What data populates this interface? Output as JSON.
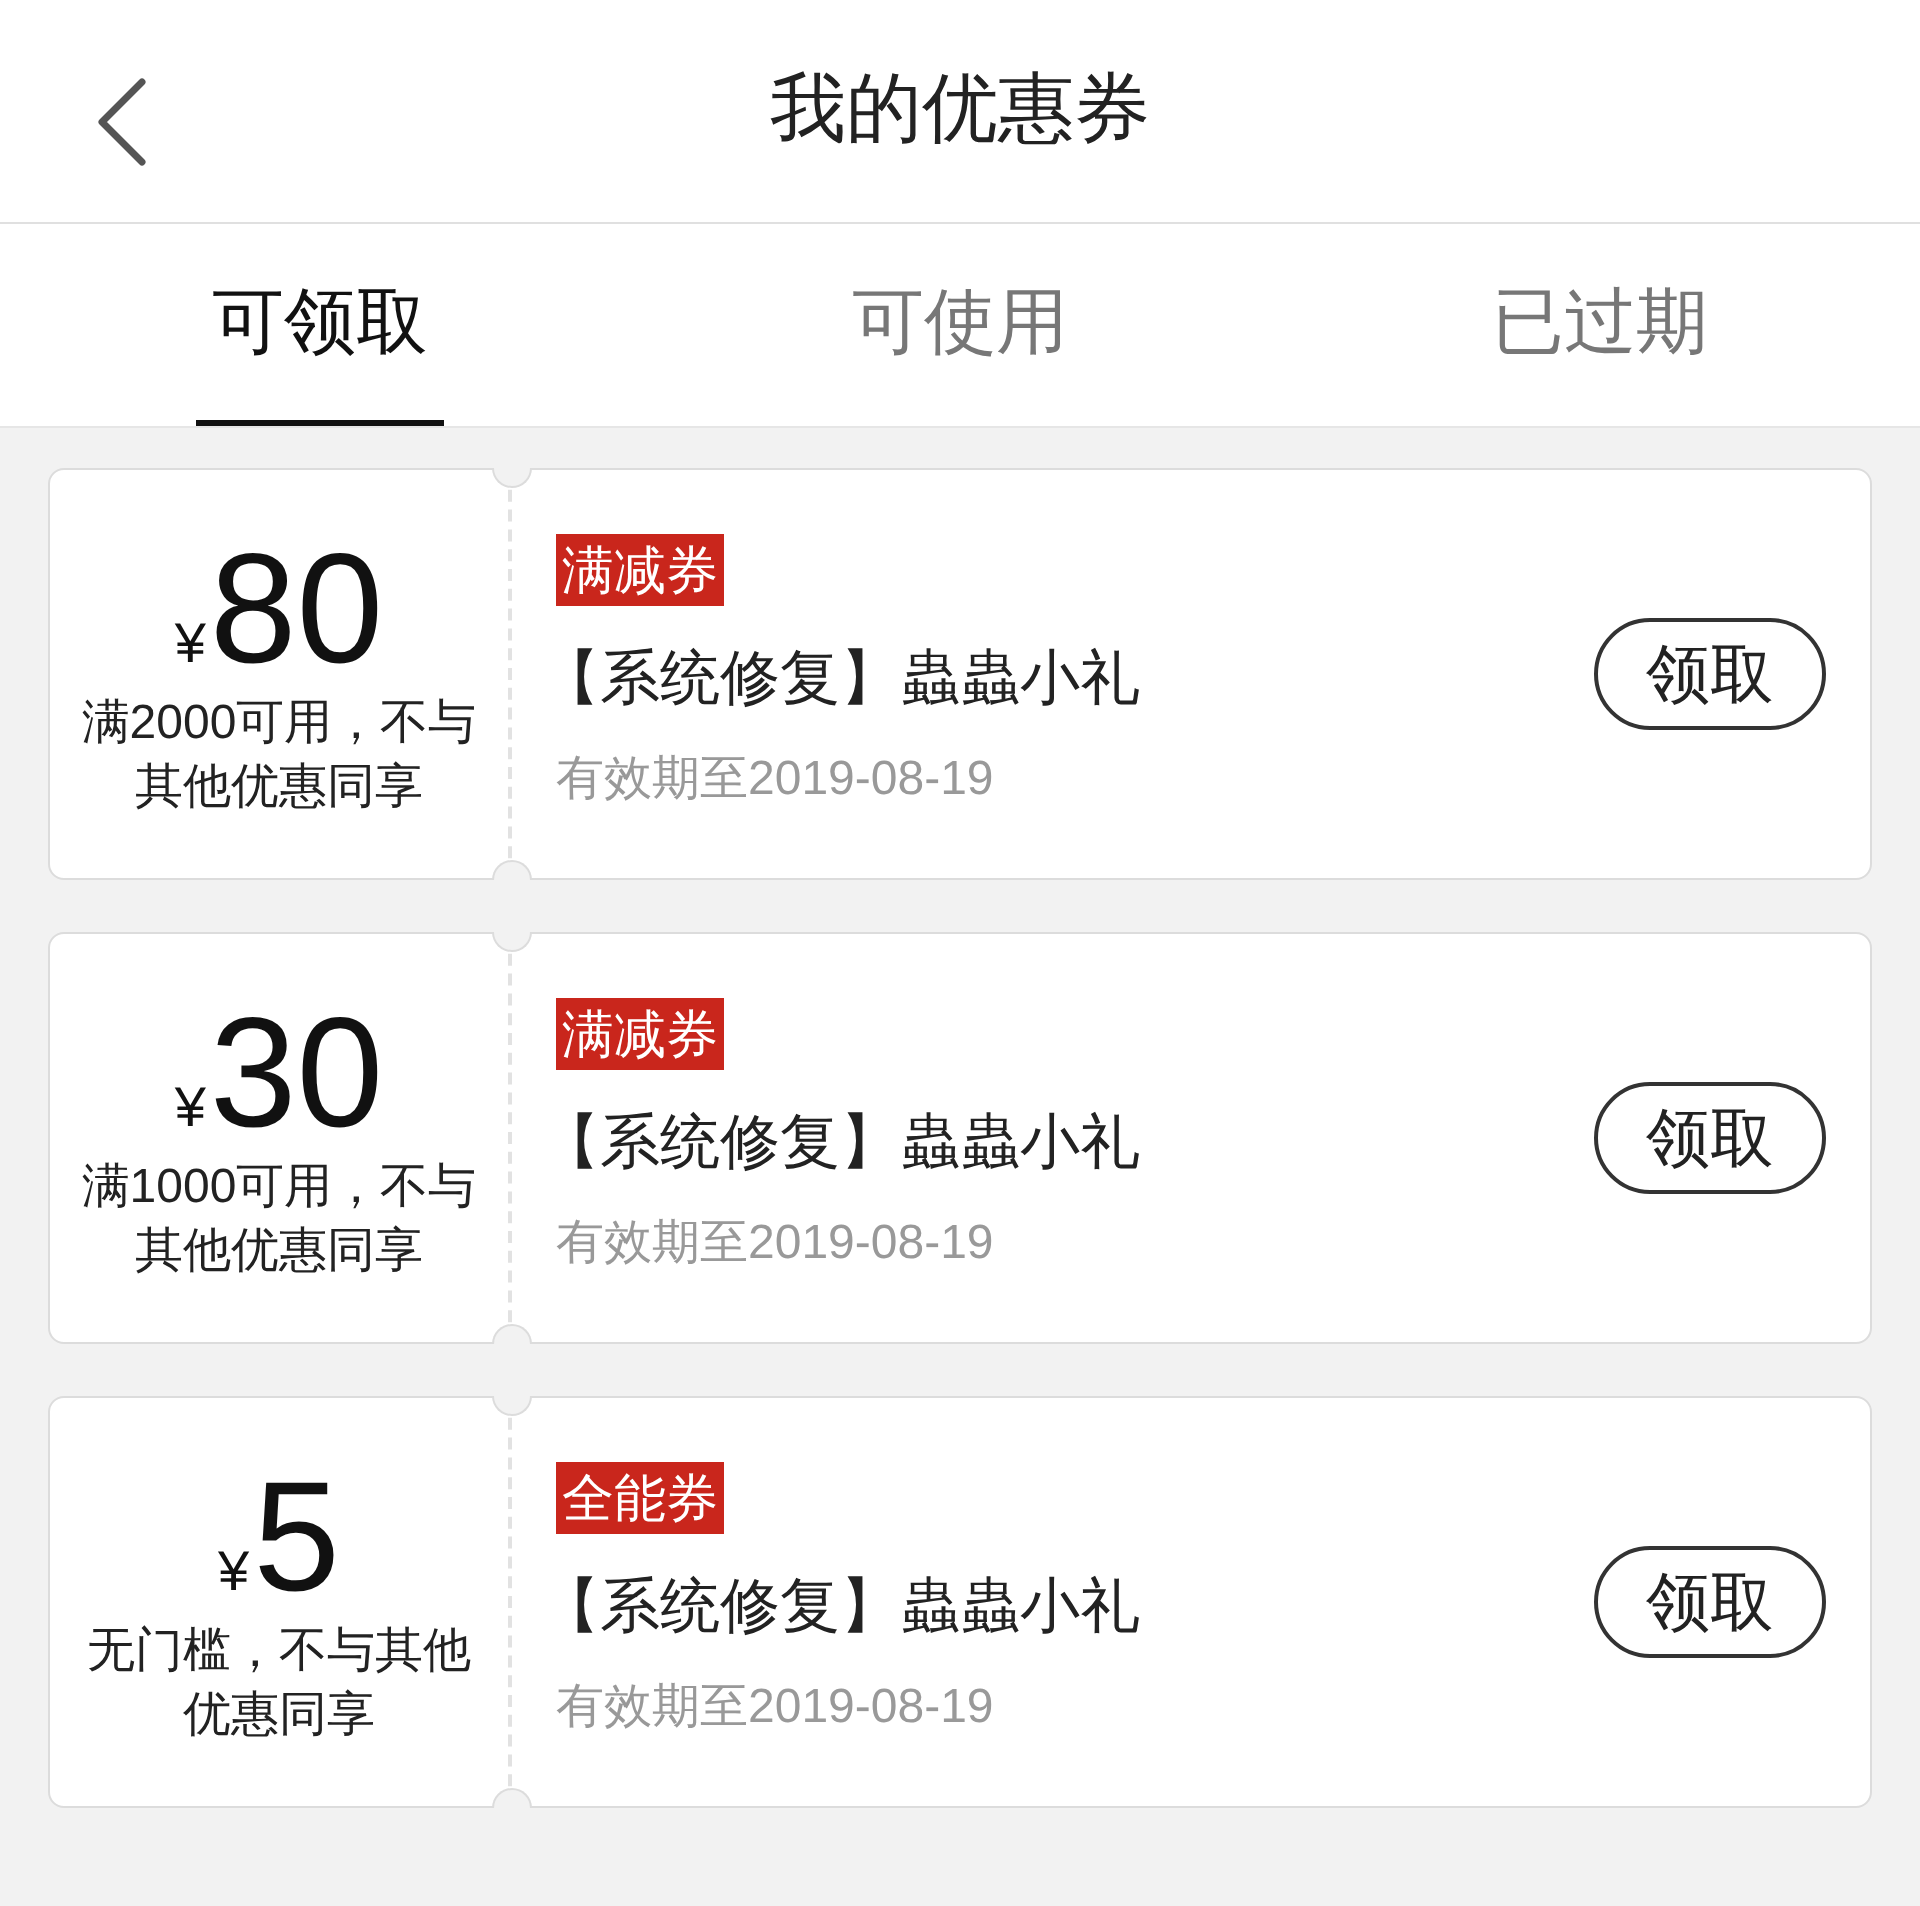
{
  "header": {
    "title": "我的优惠券"
  },
  "tabs": [
    {
      "label": "可领取",
      "selected": true
    },
    {
      "label": "可使用",
      "selected": false
    },
    {
      "label": "已过期",
      "selected": false
    }
  ],
  "coupons": [
    {
      "currency": "¥",
      "amount": "80",
      "condition": "满2000可用，不与其他优惠同享",
      "tag": "满减券",
      "title": "【系统修复】蟲蟲小礼",
      "validity": "有效期至2019-08-19",
      "button": "领取"
    },
    {
      "currency": "¥",
      "amount": "30",
      "condition": "满1000可用，不与其他优惠同享",
      "tag": "满减券",
      "title": "【系统修复】蟲蟲小礼",
      "validity": "有效期至2019-08-19",
      "button": "领取"
    },
    {
      "currency": "¥",
      "amount": "5",
      "condition": "无门槛，不与其他优惠同享",
      "tag": "全能券",
      "title": "【系统修复】蟲蟲小礼",
      "validity": "有效期至2019-08-19",
      "button": "领取"
    }
  ]
}
